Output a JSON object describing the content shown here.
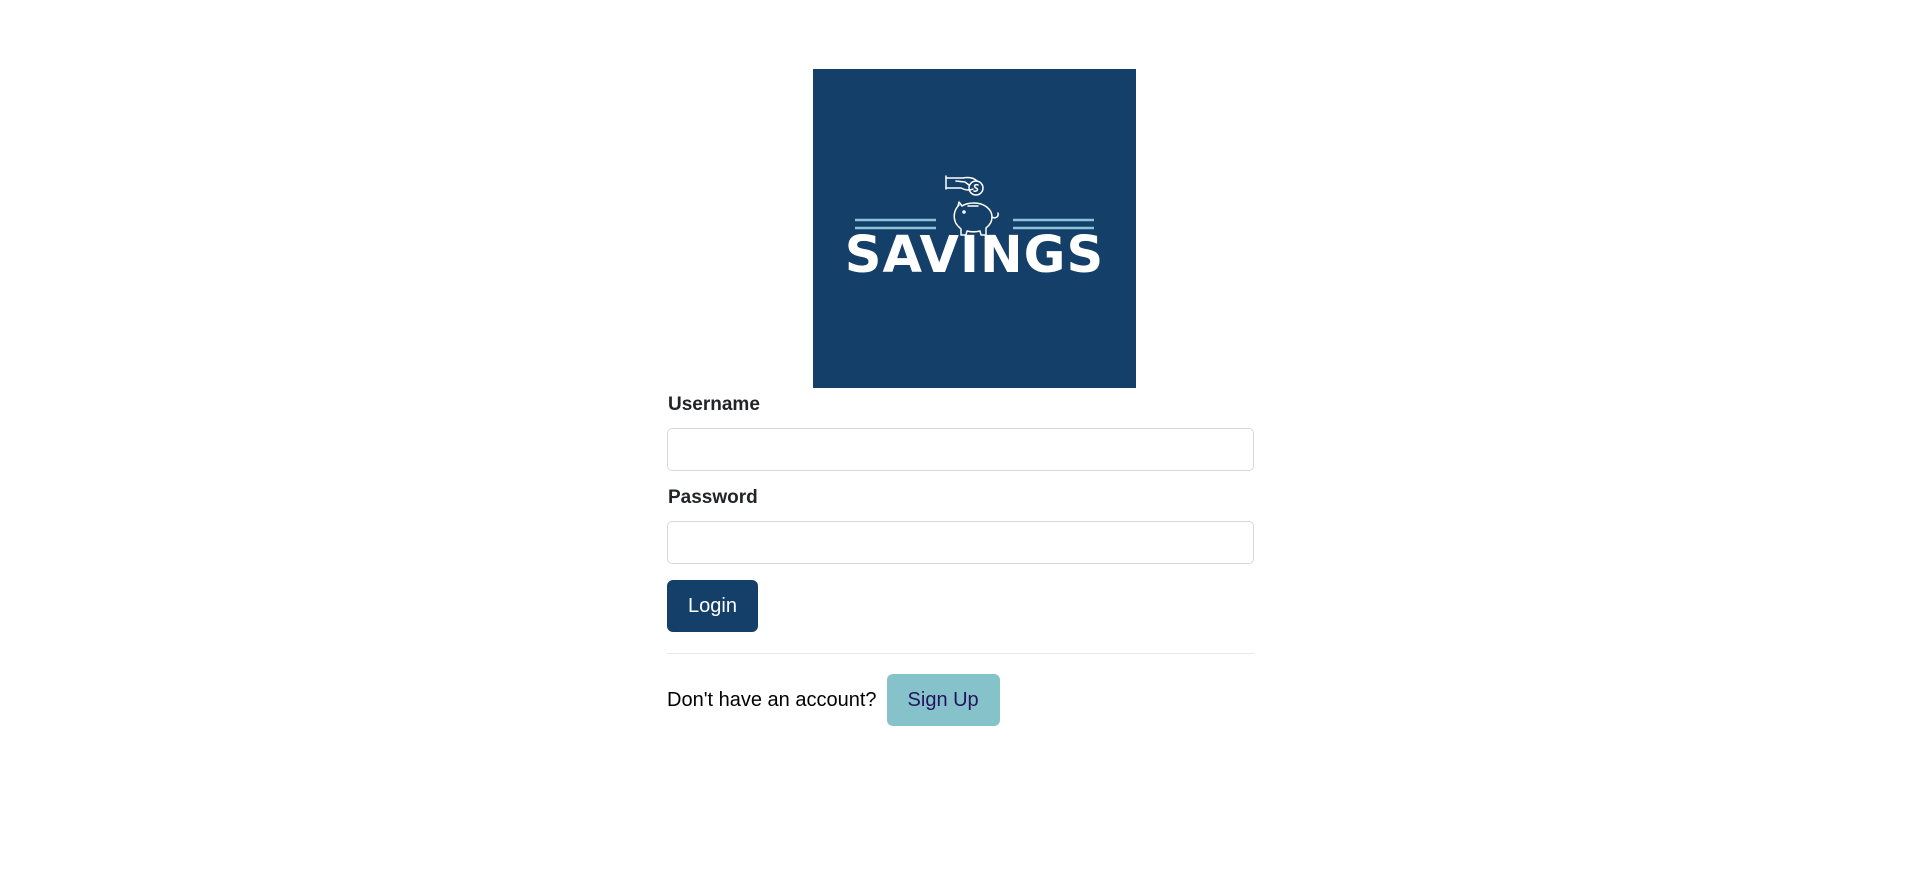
{
  "logo": {
    "text": "SAVINGS",
    "background": "#143f68",
    "accent_lines": "#8dc3d9",
    "icon": "piggy-bank-coin-hand-icon"
  },
  "form": {
    "username_label": "Username",
    "username_value": "",
    "password_label": "Password",
    "password_value": "",
    "login_label": "Login"
  },
  "signup": {
    "prompt": "Don't have an account?",
    "button_label": "Sign Up"
  },
  "colors": {
    "primary": "#143f68",
    "secondary": "#86c2c9"
  }
}
